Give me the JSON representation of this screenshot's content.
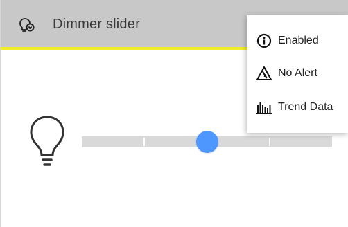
{
  "header": {
    "title": "Dimmer slider",
    "icon": "dimmer-bulb-icon"
  },
  "dimmer": {
    "icon": "lightbulb-icon",
    "level_percent": 50,
    "tick_marks": 3
  },
  "menu": {
    "items": [
      {
        "label": "Enabled",
        "icon": "info-circle-icon"
      },
      {
        "label": "No Alert",
        "icon": "alert-triangle-icon"
      },
      {
        "label": "Trend Data",
        "icon": "trend-data-icon"
      }
    ]
  },
  "colors": {
    "header_bg": "#c8c8c8",
    "header_accent": "#f3ee2b",
    "thumb": "#4d97ff",
    "track": "#d9d9d9"
  }
}
